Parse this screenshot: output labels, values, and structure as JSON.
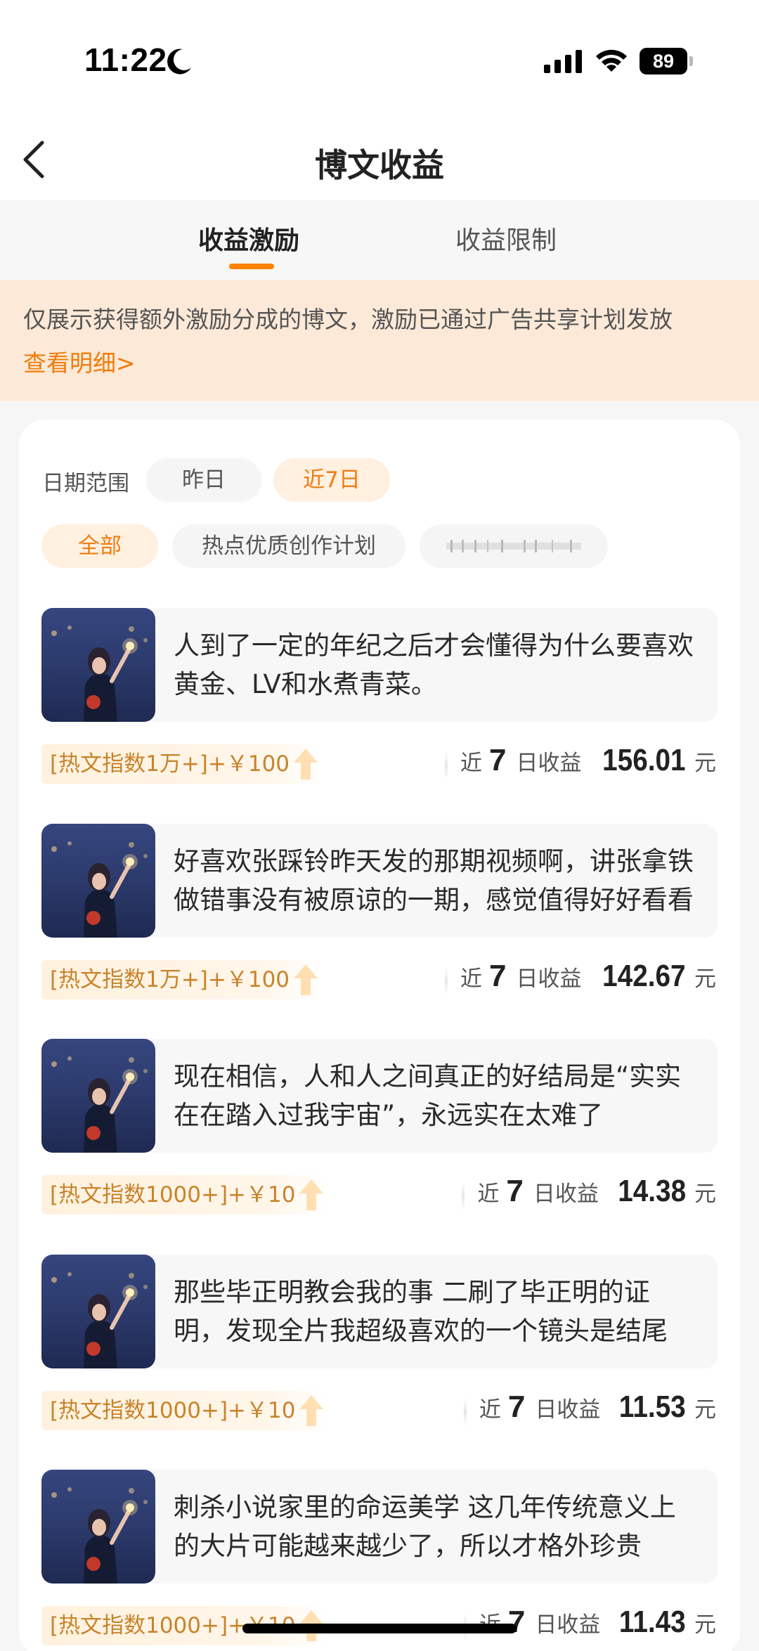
{
  "status_bar": {
    "time": "11:22",
    "battery": "89"
  },
  "nav": {
    "title": "博文收益"
  },
  "tabs": [
    {
      "label": "收益激励",
      "active": true
    },
    {
      "label": "收益限制",
      "active": false
    }
  ],
  "notice": {
    "text": "仅展示获得额外激励分成的博文，激励已通过广告共享计划发放",
    "link": "查看明细>"
  },
  "filters": {
    "date_label": "日期范围",
    "date_options": [
      {
        "label": "昨日",
        "selected": false
      },
      {
        "label": "近7日",
        "selected": true
      }
    ],
    "category_options": [
      {
        "label": "全部",
        "selected": true
      },
      {
        "label": "热点优质创作计划",
        "selected": false
      },
      {
        "label": "",
        "selected": false
      }
    ]
  },
  "posts": [
    {
      "text": "人到了一定的年纪之后才会懂得为什么要喜欢黄金、LV和水煮青菜。",
      "tag": "[热文指数1万+]+￥100",
      "prefix": "近",
      "days": "7",
      "suffix": "日收益",
      "amount": "156.01",
      "unit": "元"
    },
    {
      "text": "好喜欢张踩铃昨天发的那期视频啊，讲张拿铁做错事没有被原谅的一期，感觉值得好好看看",
      "tag": "[热文指数1万+]+￥100",
      "prefix": "近",
      "days": "7",
      "suffix": "日收益",
      "amount": "142.67",
      "unit": "元"
    },
    {
      "text": "现在相信，人和人之间真正的好结局是“实实在在踏入过我宇宙”，永远实在太难了",
      "tag": "[热文指数1000+]+￥10",
      "prefix": "近",
      "days": "7",
      "suffix": "日收益",
      "amount": "14.38",
      "unit": "元"
    },
    {
      "text": "那些毕正明教会我的事 二刷了毕正明的证明，发现全片我超级喜欢的一个镜头是结尾",
      "tag": "[热文指数1000+]+￥10",
      "prefix": "近",
      "days": "7",
      "suffix": "日收益",
      "amount": "11.53",
      "unit": "元"
    },
    {
      "text": "刺杀小说家里的命运美学 这几年传统意义上的大片可能越来越少了，所以才格外珍贵",
      "tag": "[热文指数1000+]+￥10",
      "prefix": "近",
      "days": "7",
      "suffix": "日收益",
      "amount": "11.43",
      "unit": "元"
    }
  ],
  "colors": {
    "accent": "#ff8200",
    "notice_bg": "#fde9d8",
    "tag_text": "#c8832c"
  }
}
